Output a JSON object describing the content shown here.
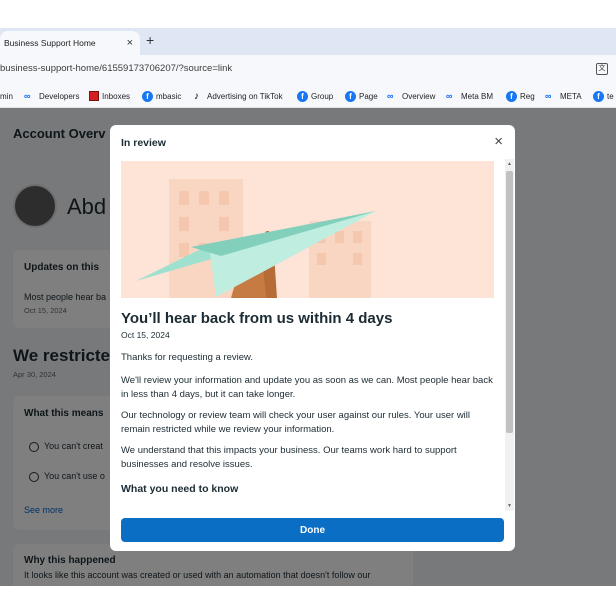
{
  "browser": {
    "tab_title": "Business Support Home",
    "close_tab_glyph": "×",
    "new_tab_glyph": "+",
    "url": "business-support-home/61559173706207/?source=link",
    "bookmarks": [
      {
        "label": "min",
        "icon": "none"
      },
      {
        "label": "Developers",
        "icon": "meta-icon"
      },
      {
        "label": "Inboxes",
        "icon": "inbox-icon"
      },
      {
        "label": "mbasic",
        "icon": "facebook-icon"
      },
      {
        "label": "Advertising on TikTok",
        "icon": "tiktok-icon"
      },
      {
        "label": "Group",
        "icon": "facebook-icon"
      },
      {
        "label": "Page",
        "icon": "facebook-icon"
      },
      {
        "label": "Overview",
        "icon": "meta-icon"
      },
      {
        "label": "Meta BM",
        "icon": "meta-icon"
      },
      {
        "label": "Reg",
        "icon": "facebook-icon"
      },
      {
        "label": "META",
        "icon": "meta-icon"
      },
      {
        "label": "te",
        "icon": "facebook-icon"
      }
    ]
  },
  "background": {
    "title": "Account Overv",
    "name": "Abd",
    "updates_title": "Updates on this",
    "updates_text": "Most people hear ba",
    "updates_date": "Oct 15, 2024",
    "restricted_heading": "We restricte",
    "restricted_date": "Apr 30, 2024",
    "means_title": "What this means",
    "means_item_1": "You can't creat",
    "means_item_2": "You can't use o",
    "see_more": "See more",
    "why_title": "Why this happened",
    "why_text": "It looks like this account was created or used with an automation that doesn't follow our"
  },
  "modal": {
    "title": "In review",
    "close_glyph": "×",
    "headline": "You’ll hear back from us within 4 days",
    "date": "Oct 15, 2024",
    "paragraphs": [
      "Thanks for requesting a review.",
      "We'll review your information and update you as soon as we can. Most people hear back in less than 4 days, but it can take longer.",
      "Our technology or review team will check your user against our rules. Your user will remain restricted while we review your information.",
      "We understand that this impacts your business. Our teams work hard to support businesses and resolve issues."
    ],
    "subheading": "What you need to know",
    "done_label": "Done"
  },
  "colors": {
    "primary_button": "#0b6ec5",
    "illustration_bg": "#fde4d6",
    "plane": "#9fe0cf",
    "hand": "#c67b42"
  }
}
